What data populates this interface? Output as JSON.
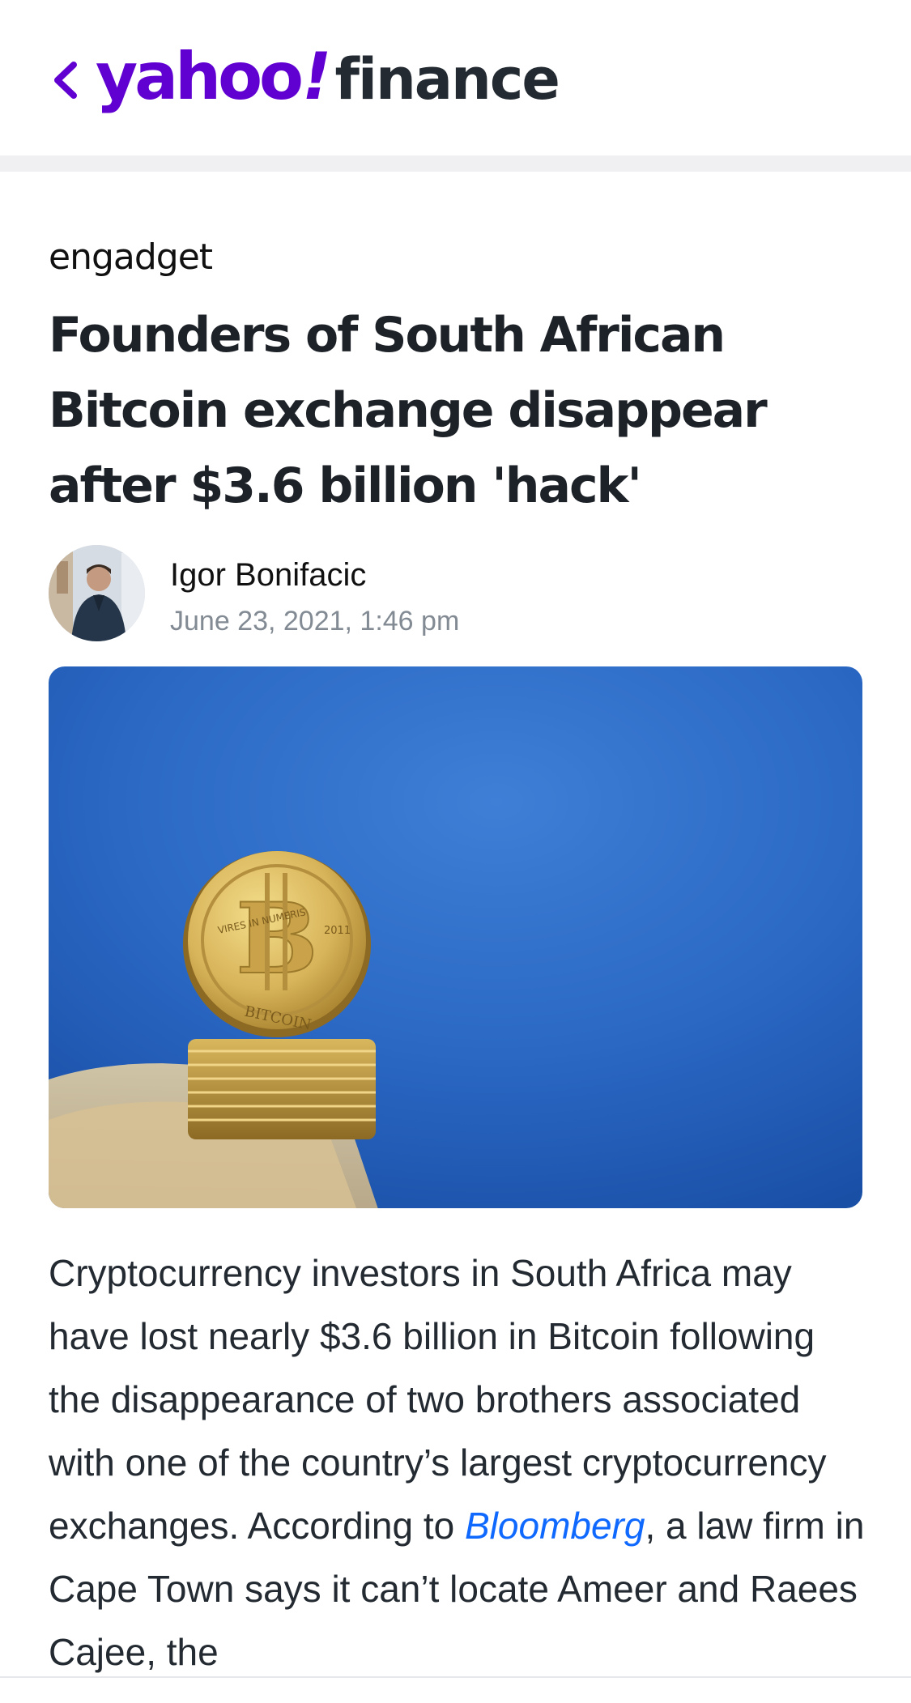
{
  "header": {
    "back_icon": "chevron-left-icon",
    "logo_yahoo": "yahoo",
    "logo_bang": "!",
    "logo_finance": "finance",
    "brand_color": "#6001d2"
  },
  "article": {
    "source": "engadget",
    "headline": "Founders of South African Bitcoin exchange disappear after $3.6 billion 'hack'",
    "author": "Igor Bonifacic",
    "date": "June 23, 2021, 1:46 pm",
    "hero_coin_text": {
      "top_left": "VIRES IN NUMERIS",
      "year": "2011",
      "bottom": "BITCOIN"
    },
    "body_before_link": "Cryptocurrency investors in South Africa may have lost nearly $3.6 billion in Bitcoin following the disappearance of two brothers associated with one of the country’s largest cryptocurrency exchanges. According to ",
    "body_link": "Bloomberg",
    "body_after_link": ", a law firm in Cape Town says it can’t locate Ameer and Raees Cajee, the",
    "link_color": "#0f69ff"
  }
}
